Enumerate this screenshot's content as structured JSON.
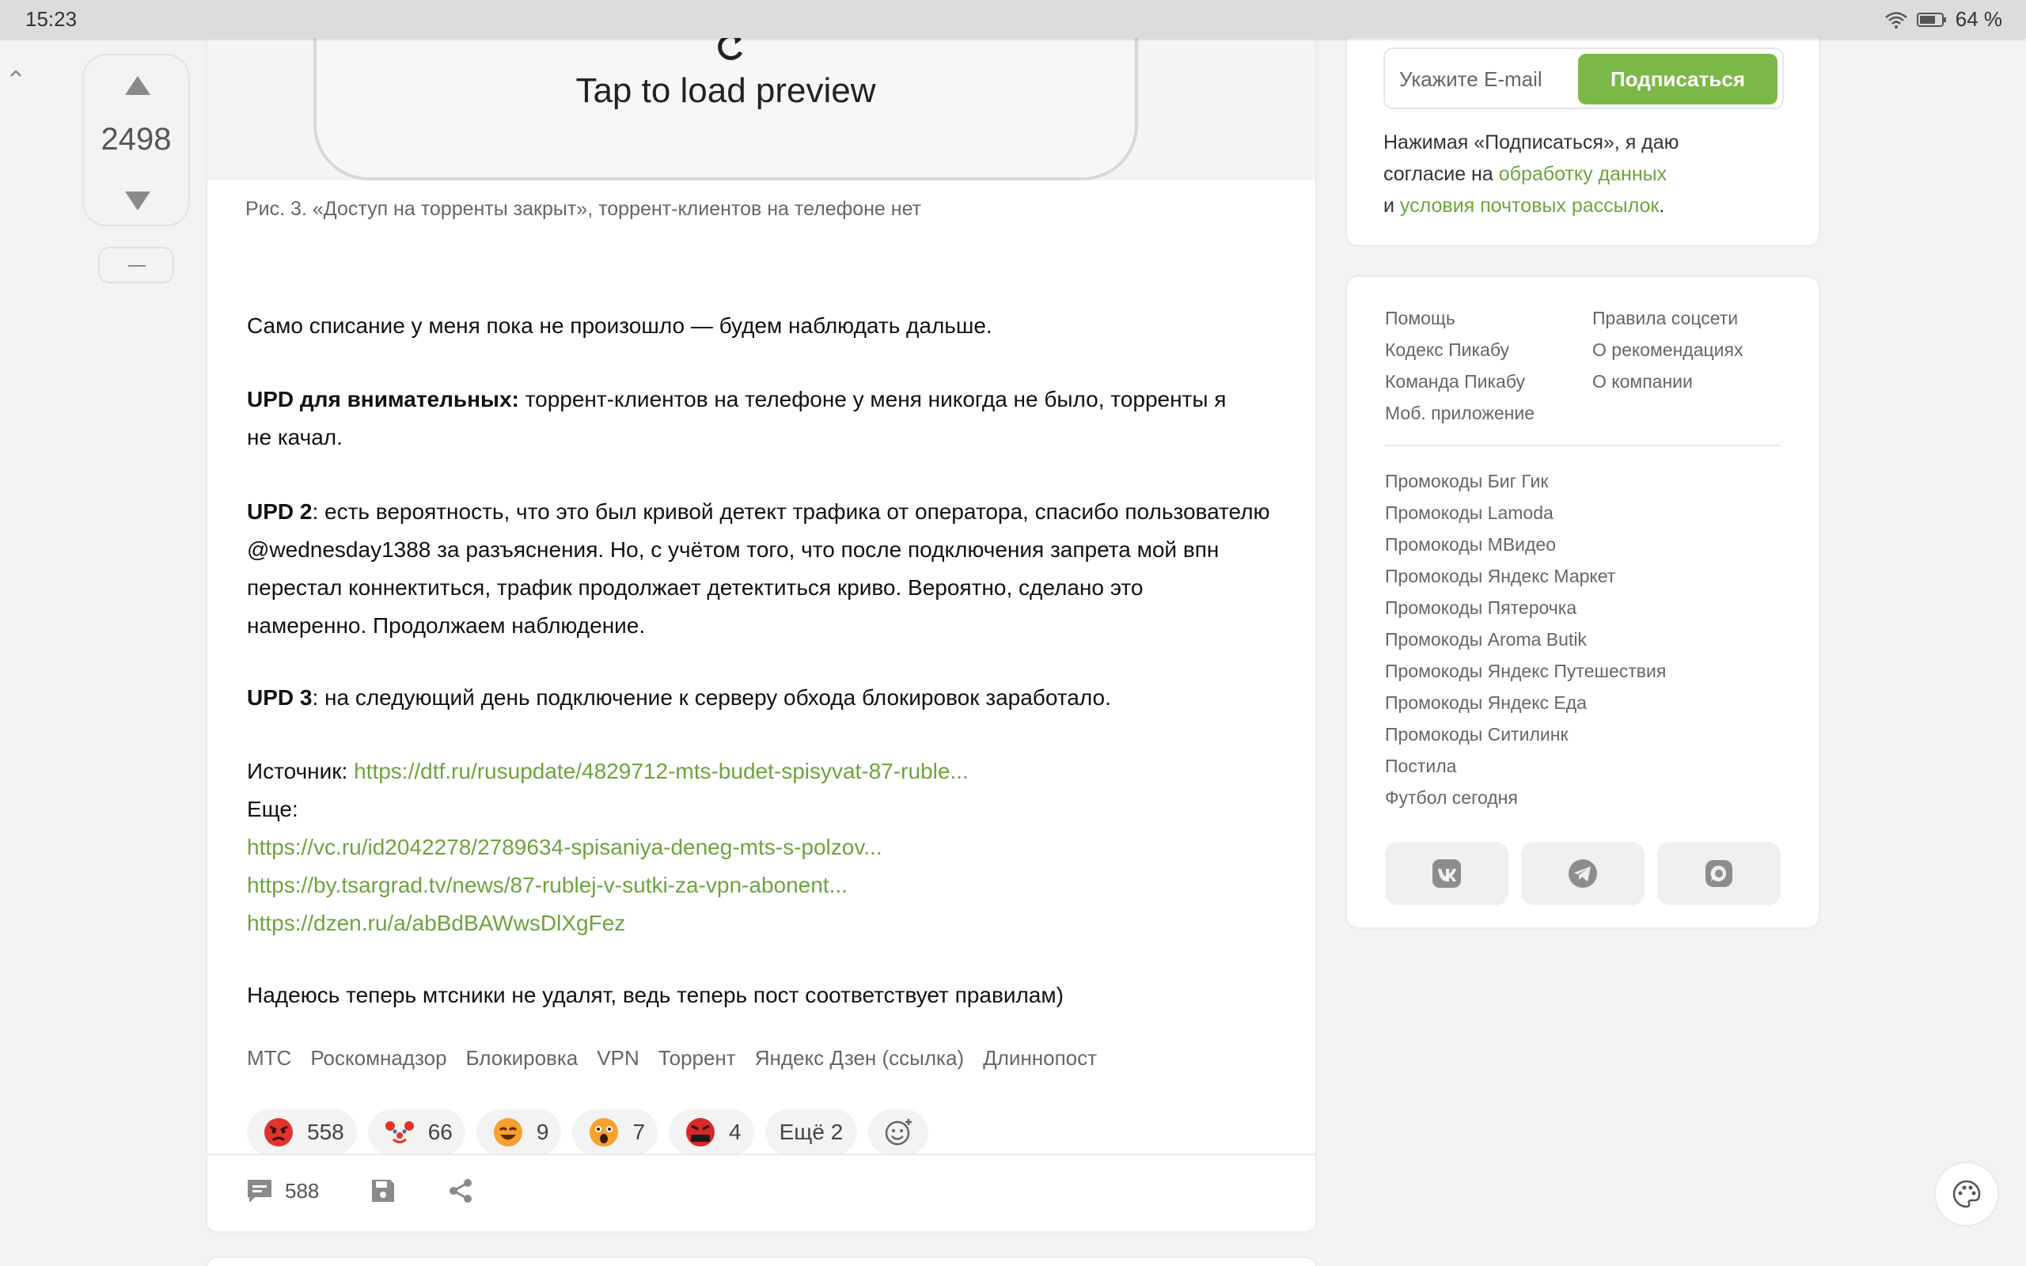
{
  "status_bar": {
    "time": "15:23",
    "battery": "64 %",
    "icons": [
      "wifi-icon",
      "battery-icon"
    ]
  },
  "vote": {
    "score": "2498"
  },
  "preview": {
    "text": "Tap to load preview"
  },
  "article": {
    "caption": "Рис. 3. «Доступ на торренты закрыт», торрент-клиентов на телефоне нет",
    "p1": "Само списание у меня пока не произошло — будем наблюдать дальше.",
    "upd1_label": "UPD для внимательных:",
    "upd1_text": " торрент-клиентов на телефоне у меня никогда не было, торренты я",
    "upd1_text2": "не качал.",
    "upd2_label": "UPD 2",
    "upd2_line1": ": есть вероятность, что это был кривой детект трафика от оператора, спасибо пользователю",
    "upd2_line2": "@wednesday1388 за разъяснения. Но, с учётом того, что после подключения запрета мой впн",
    "upd2_line3": "перестал коннектиться, трафик продолжает детектиться криво. Вероятно, сделано это",
    "upd2_line4": "намеренно. Продолжаем наблюдение.",
    "upd3_label": "UPD 3",
    "upd3_text": ": на следующий день подключение к серверу обхода блокировок заработало.",
    "source_label": "Источник: ",
    "source_link": "https://dtf.ru/rusupdate/4829712-mts-budet-spisyvat-87-ruble...",
    "more_label": "Еще:",
    "more_links": [
      "https://vc.ru/id2042278/2789634-spisaniya-deneg-mts-s-polzov...",
      "https://by.tsargrad.tv/news/87-rublej-v-sutki-za-vpn-abonent...",
      "https://dzen.ru/a/abBdBAWwsDlXgFez"
    ],
    "closing": "Надеюсь теперь мтсники не удалят, ведь теперь пост соответствует правилам)"
  },
  "tags": [
    "МТС",
    "Роскомнадзор",
    "Блокировка",
    "VPN",
    "Торрент",
    "Яндекс Дзен (ссылка)",
    "Длиннопост"
  ],
  "reactions": [
    {
      "icon": "angry-face-icon",
      "count": "558"
    },
    {
      "icon": "clown-face-icon",
      "count": "66"
    },
    {
      "icon": "laughing-face-icon",
      "count": "9"
    },
    {
      "icon": "shocked-face-icon",
      "count": "7"
    },
    {
      "icon": "cursing-face-icon",
      "count": "4"
    }
  ],
  "reactions_more": "Ещё 2",
  "footer": {
    "comments_count": "588"
  },
  "sidebar": {
    "email_placeholder": "Укажите E-mail",
    "subscribe_label": "Подписаться",
    "consent_prefix": "Нажимая «Подписаться», я даю",
    "consent_mid": "согласие на ",
    "consent_link1": "обработку данных",
    "consent_and": "и ",
    "consent_link2": "условия почтовых рассылок",
    "consent_end": ".",
    "links_col1": [
      "Помощь",
      "Кодекс Пикабу",
      "Команда Пикабу",
      "Моб. приложение"
    ],
    "links_col2": [
      "Правила соцсети",
      "О рекомендациях",
      "О компании"
    ],
    "promo_links": [
      "Промокоды Биг Гик",
      "Промокоды Lamoda",
      "Промокоды МВидео",
      "Промокоды Яндекс Маркет",
      "Промокоды Пятерочка",
      "Промокоды Aroma Butik",
      "Промокоды Яндекс Путешествия",
      "Промокоды Яндекс Еда",
      "Промокоды Ситилинк",
      "Постила",
      "Футбол сегодня"
    ],
    "social": [
      "vk-icon",
      "telegram-icon",
      "chat-icon"
    ]
  },
  "colors": {
    "accent_green": "#7bb848",
    "link_green": "#6da43e",
    "background": "#f3f3f3"
  }
}
